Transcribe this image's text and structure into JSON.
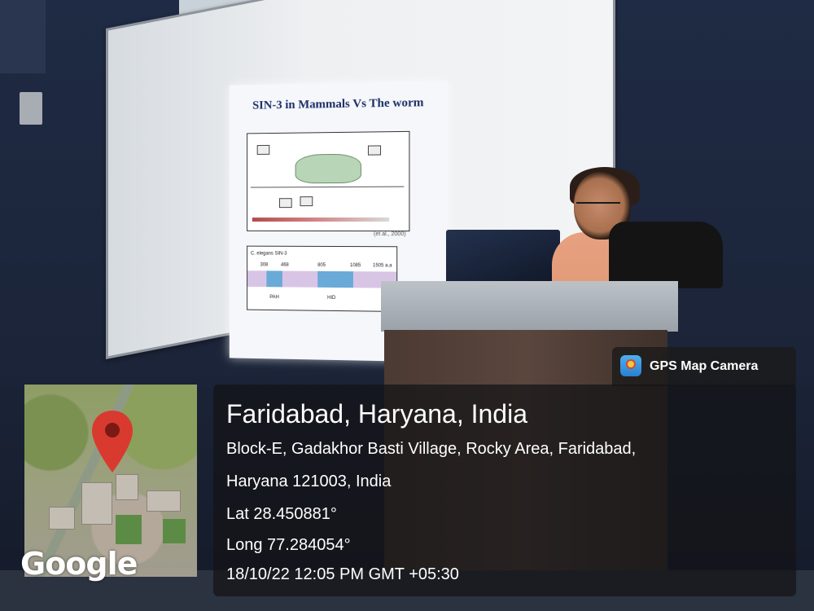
{
  "slide": {
    "title": "SIN-3 in Mammals Vs The worm",
    "figure1_caption": "(et al., 2000)",
    "figure2_title": "C. elegans SIN-3",
    "figure2_ticks": [
      "308",
      "468",
      "805",
      "1085",
      "1505 a.a"
    ],
    "figure2_labels": [
      "PAH",
      "HID"
    ]
  },
  "map": {
    "watermark": "Google",
    "pin_color": "#d93a2f"
  },
  "overlay": {
    "app_name": "GPS Map Camera",
    "location_title": "Faridabad, Haryana, India",
    "address_line1": "Block-E, Gadakhor Basti Village, Rocky Area, Faridabad,",
    "address_line2": "Haryana 121003, India",
    "latitude": "Lat 28.450881°",
    "longitude": "Long 77.284054°",
    "timestamp": "18/10/22 12:05 PM GMT +05:30"
  }
}
